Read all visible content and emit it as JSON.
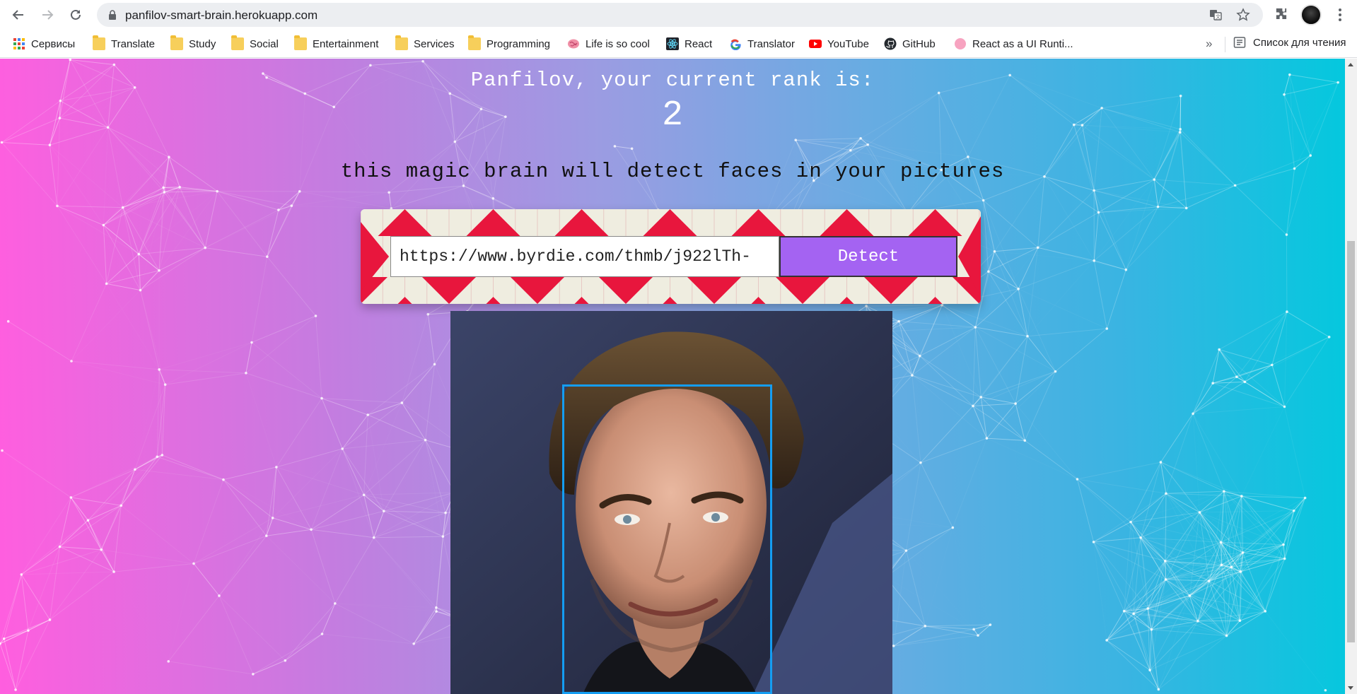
{
  "browser": {
    "url": "panfilov-smart-brain.herokuapp.com",
    "bookmarks": [
      {
        "label": "Сервисы",
        "icon": "apps-grid-icon"
      },
      {
        "label": "Translate",
        "icon": "folder-icon"
      },
      {
        "label": "Study",
        "icon": "folder-icon"
      },
      {
        "label": "Social",
        "icon": "folder-icon"
      },
      {
        "label": "Entertainment",
        "icon": "folder-icon"
      },
      {
        "label": "Services",
        "icon": "folder-icon"
      },
      {
        "label": "Programming",
        "icon": "folder-icon"
      },
      {
        "label": "Life is so cool",
        "icon": "brain-icon"
      },
      {
        "label": "React",
        "icon": "react-icon"
      },
      {
        "label": "Translator",
        "icon": "google-icon"
      },
      {
        "label": "YouTube",
        "icon": "youtube-icon"
      },
      {
        "label": "GitHub",
        "icon": "github-icon"
      },
      {
        "label": "React as a UI Runti...",
        "icon": "pink-circle-icon"
      }
    ],
    "overflow_chevron": "»",
    "reading_list": "Список для чтения"
  },
  "page": {
    "rank_title": "Panfilov, your current rank is:",
    "rank_value": "2",
    "tagline": "this magic brain will detect faces in your pictures",
    "input_value": "https://www.byrdie.com/thmb/j922lTh-",
    "detect_label": "Detect"
  },
  "colors": {
    "gradient_left": "#ff5edf",
    "gradient_right": "#04c8de",
    "detect_button": "#a463f2",
    "face_box": "#149df2",
    "pattern_red": "#e8163d",
    "pattern_cream": "#efede0"
  }
}
